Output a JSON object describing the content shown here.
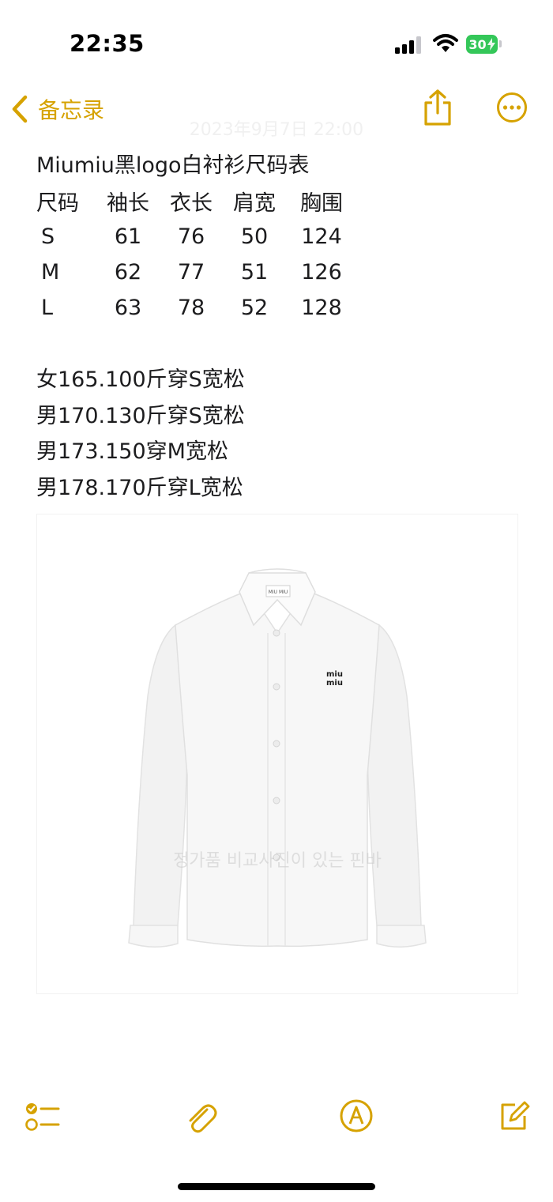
{
  "status_bar": {
    "time": "22:35",
    "battery": "30"
  },
  "nav": {
    "back_label": "备忘录",
    "date": "2023年9月7日 22:00"
  },
  "note": {
    "title": "Miumiu黑logo白衬衫尺码表",
    "table": {
      "headers": [
        "尺码",
        "袖长",
        "衣长",
        "肩宽",
        "胸围"
      ],
      "rows": [
        [
          "S",
          "61",
          "76",
          "50",
          "124"
        ],
        [
          "M",
          "62",
          "77",
          "51",
          "126"
        ],
        [
          "L",
          "63",
          "78",
          "52",
          "128"
        ]
      ]
    },
    "fit_lines": [
      "女165.100斤穿S宽松",
      "男170.130斤穿S宽松",
      "男173.150穿M宽松",
      "男178.170斤穿L宽松"
    ],
    "photo": {
      "logo_text_1": "miu",
      "logo_text_2": "miu",
      "label_text": "MIU MIU",
      "watermark": "정가품 비교사진이 있는 핀바"
    }
  },
  "colors": {
    "accent": "#d6a200",
    "battery": "#34c759",
    "text": "#1c1c1e"
  },
  "icons": {
    "back": "chevron-left-icon",
    "share": "share-icon",
    "more": "ellipsis-circle-icon",
    "checklist": "checklist-icon",
    "attach": "paperclip-icon",
    "markup": "pen-circle-icon",
    "compose": "compose-icon"
  }
}
